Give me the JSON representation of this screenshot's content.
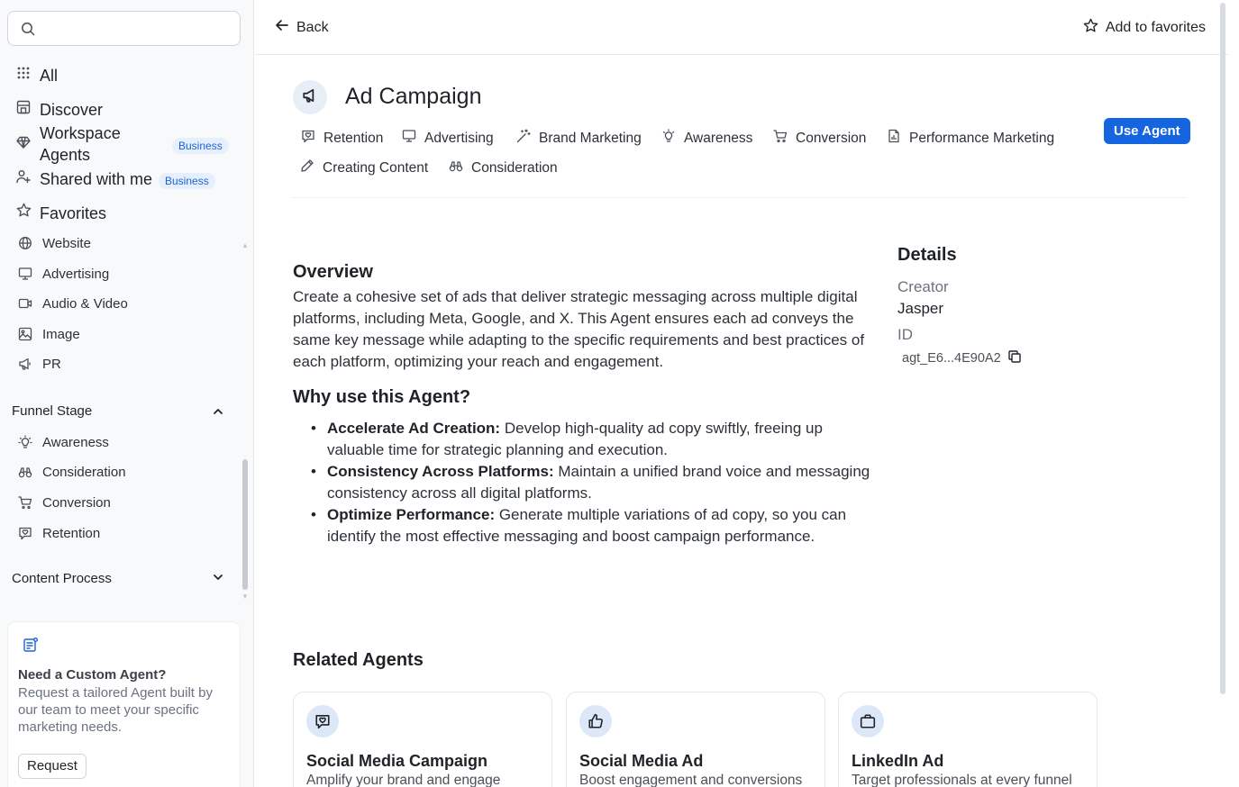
{
  "sidebar": {
    "search": {
      "placeholder": ""
    },
    "main_items": [
      {
        "label": "All"
      },
      {
        "label": "Discover"
      },
      {
        "label": "Workspace Agents",
        "line1": "Workspace",
        "line2": "Agents",
        "badge": "Business"
      },
      {
        "label": "Shared with me",
        "badge": "Business"
      },
      {
        "label": "Favorites"
      }
    ],
    "sub_items": [
      {
        "label": "Website"
      },
      {
        "label": "Advertising"
      },
      {
        "label": "Audio & Video"
      },
      {
        "label": "Image"
      },
      {
        "label": "PR"
      }
    ],
    "funnel_stage": {
      "title": "Funnel Stage",
      "items": [
        {
          "label": "Awareness"
        },
        {
          "label": "Consideration"
        },
        {
          "label": "Conversion"
        },
        {
          "label": "Retention"
        }
      ]
    },
    "content_process": {
      "title": "Content Process"
    },
    "promo": {
      "title": "Need a Custom Agent?",
      "description": "Request a tailored Agent built by our team to meet your specific marketing needs.",
      "button": "Request"
    }
  },
  "topbar": {
    "back": "Back",
    "favorites": "Add to favorites"
  },
  "agent": {
    "title": "Ad Campaign",
    "tags": [
      {
        "label": "Retention",
        "icon": "retention-icon"
      },
      {
        "label": "Advertising",
        "icon": "monitor-icon"
      },
      {
        "label": "Brand Marketing",
        "icon": "magic-wand-icon"
      },
      {
        "label": "Awareness",
        "icon": "lightbulb-icon"
      },
      {
        "label": "Conversion",
        "icon": "cart-icon"
      },
      {
        "label": "Performance Marketing",
        "icon": "report-icon"
      },
      {
        "label": "Creating Content",
        "icon": "pencil-icon"
      },
      {
        "label": "Consideration",
        "icon": "binoculars-icon"
      }
    ],
    "use_button": "Use Agent",
    "overview_title": "Overview",
    "overview_text": "Create a cohesive set of ads that deliver strategic messaging across multiple digital platforms, including Meta, Google, and X. This Agent ensures each ad conveys the same key message while adapting to the specific requirements and best practices of each platform, optimizing your reach and engagement.",
    "why_title": "Why use this Agent?",
    "benefits": [
      {
        "title": "Accelerate Ad Creation:",
        "text": " Develop high-quality ad copy swiftly, freeing up valuable time for strategic planning and execution."
      },
      {
        "title": "Consistency Across Platforms:",
        "text": " Maintain a unified brand voice and messaging consistency across all digital platforms."
      },
      {
        "title": "Optimize Performance:",
        "text": " Generate multiple variations of ad copy, so you can identify the most effective messaging and boost campaign performance."
      }
    ]
  },
  "details": {
    "title": "Details",
    "creator_label": "Creator",
    "creator_value": "Jasper",
    "id_label": "ID",
    "id_value": "agt_E6...4E90A2"
  },
  "related": {
    "title": "Related Agents",
    "cards": [
      {
        "title": "Social Media Campaign",
        "desc": "Amplify your brand and engage",
        "icon": "chat-heart-icon"
      },
      {
        "title": "Social Media Ad",
        "desc": "Boost engagement and conversions",
        "icon": "thumbs-up-icon"
      },
      {
        "title": "LinkedIn Ad",
        "desc": "Target professionals at every funnel",
        "icon": "briefcase-icon"
      }
    ]
  },
  "colors": {
    "accent": "#1565e0",
    "badge_bg": "#e6effc",
    "badge_text": "#1e63d6",
    "sidebar_bg": "#f8f9fa"
  }
}
